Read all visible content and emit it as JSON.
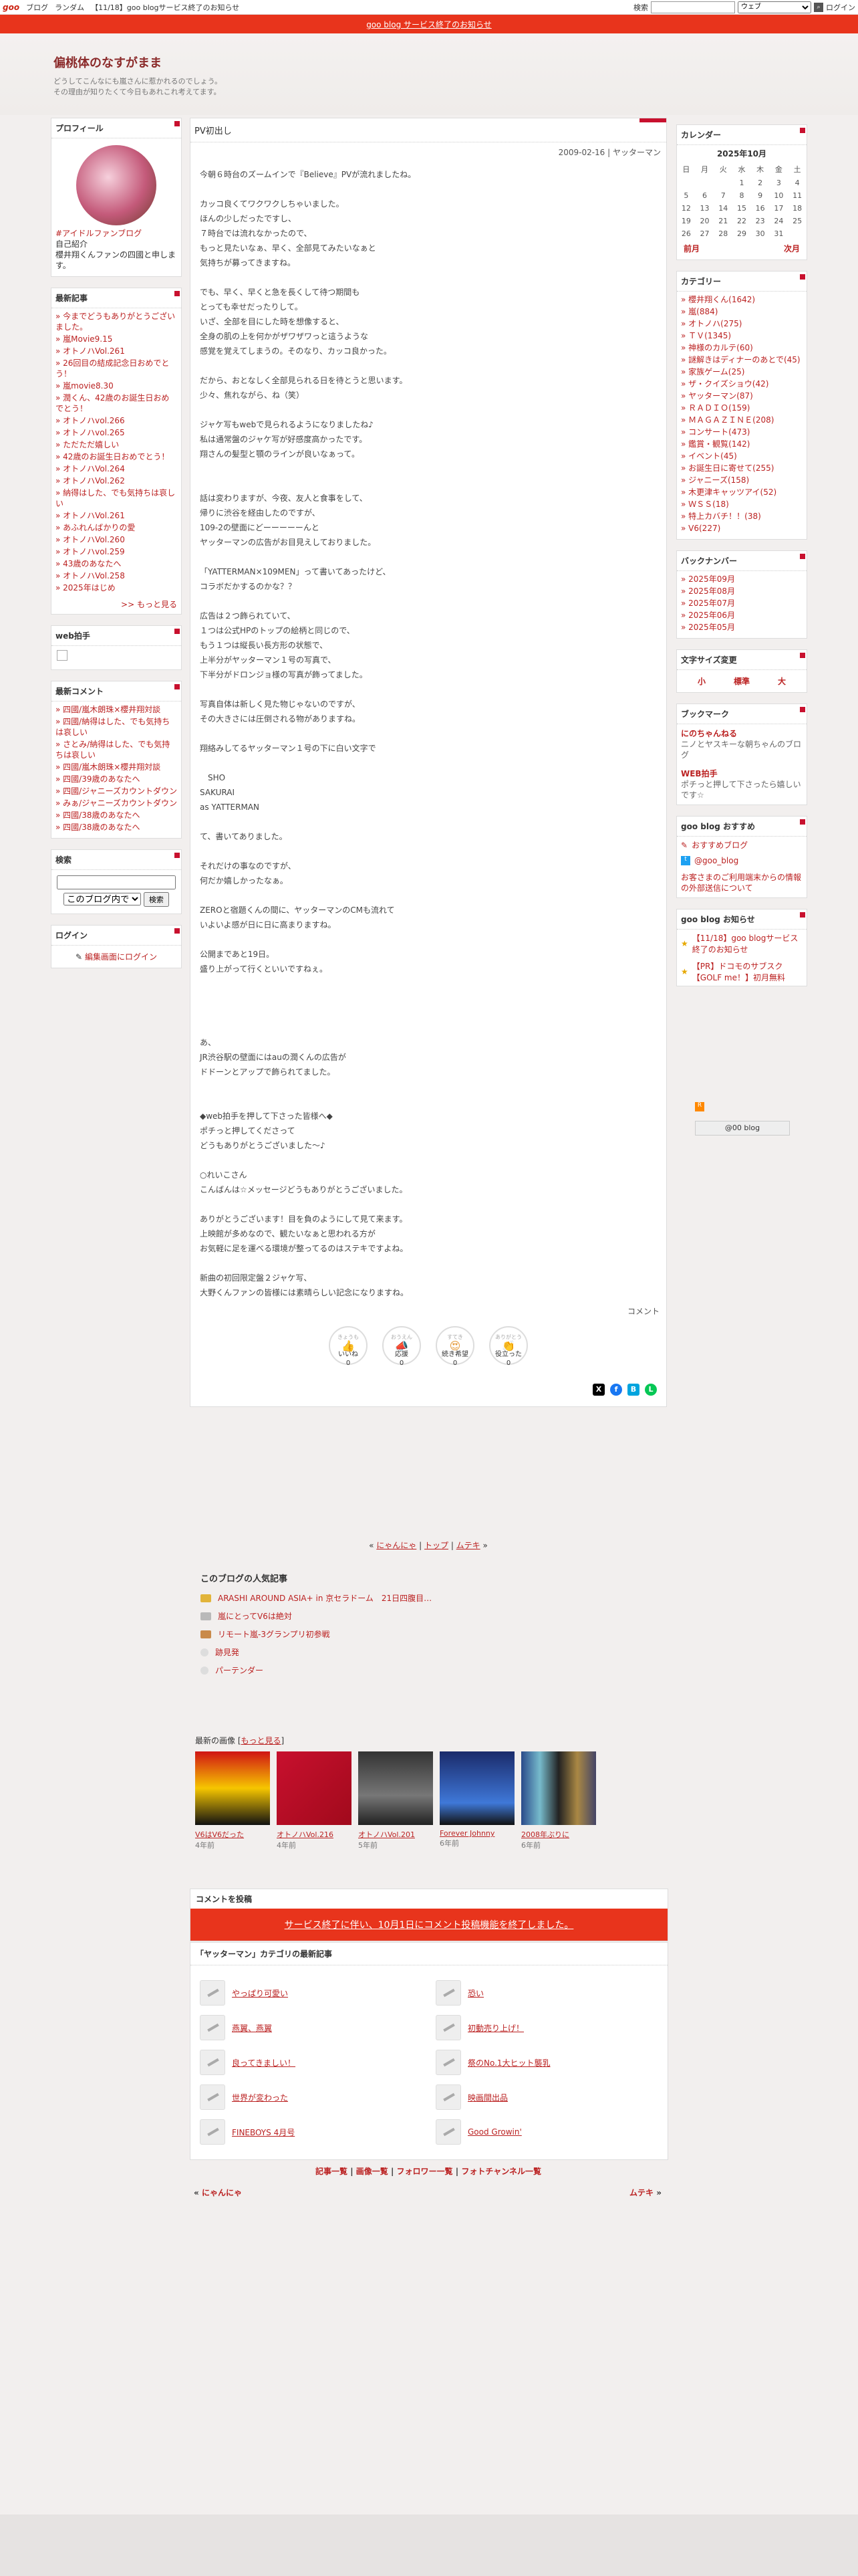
{
  "topbar": {
    "logo": "goo",
    "links": [
      "ブログ",
      "ランダム",
      "【11/18】goo blogサービス終了のお知らせ"
    ],
    "search_label": "検索",
    "search_select": "ウェブ",
    "login": "ログイン"
  },
  "banner": "goo blog サービス終了のお知らせ",
  "blog": {
    "title": "偏桃体のなすがまま",
    "desc1": "どうしてこんなにも嵐さんに惹かれるのでしょう。",
    "desc2": "その理由が知りたくて今日もあれこれ考えてます。"
  },
  "profile": {
    "head": "プロフィール",
    "tag": "#アイドルファンブログ",
    "intro_label": "自己紹介",
    "intro": "櫻井翔くんファンの四國と申します。"
  },
  "recent": {
    "head": "最新記事",
    "items": [
      "今までどうもありがとうございました。",
      "嵐Movie9.15",
      "オトノハVol.261",
      "26回目の結成記念日おめでとう！",
      "嵐movie8.30",
      "潤くん、42歳のお誕生日おめでとう！",
      "オトノハvol.266",
      "オトノハvol.265",
      "ただただ嬉しい",
      "42歳のお誕生日おめでとう！",
      "オトノハVol.264",
      "オトノハVol.262",
      "納得はした、でも気持ちは哀しい",
      "オトノハVol.261",
      "あふれんばかりの愛",
      "オトノハVol.260",
      "オトノハvol.259",
      "43歳のあなたへ",
      "オトノハVol.258",
      "2025年はじめ"
    ],
    "more": "もっと見る"
  },
  "webclap": {
    "head": "web拍手"
  },
  "comments": {
    "head": "最新コメント",
    "items": [
      "四國/嵐木朗珠×櫻井翔対談",
      "四國/納得はした、でも気持ちは哀しい",
      "さとみ/納得はした、でも気持ちは哀しい",
      "四國/嵐木朗珠×櫻井翔対談",
      "四國/39歳のあなたへ",
      "四國/ジャニーズカウントダウン",
      "みぁ/ジャニーズカウントダウン",
      "四國/38歳のあなたへ",
      "四國/38歳のあなたへ"
    ]
  },
  "search": {
    "head": "検索",
    "scope": "このブログ内で",
    "btn": "検索"
  },
  "login": {
    "head": "ログイン",
    "link": "編集画面にログイン"
  },
  "post": {
    "title": "PV初出し",
    "date": "2009-02-16 | ヤッターマン",
    "body": "今朝６時台のズームインで『Believe』PVが流れましたね。\n\nカッコ良くてワクワクしちゃいました。\nほんの少しだったですし、\n７時台では流れなかったので、\nもっと見たいなぁ、早く、全部見てみたいなぁと\n気持ちが募ってきますね。\n\nでも、早く、早くと急を長くして待つ期間も\nとっても幸せだったりして。\nいざ、全部を目にした時を想像すると、\n全身の肌の上を何かがザワザワっと這うような\n感覚を覚えてしまうの。そのなり、カッコ良かった。\n\nだから、おとなしく全部見られる日を待とうと思います。\n少々、焦れながら、ね（笑）\n\nジャケ写もwebで見られるようになりましたね♪\n私は通常盤のジャケ写が好感度高かったです。\n翔さんの髪型と顎のラインが良いなぁって。\n\n\n話は変わりますが、今夜、友人と食事をして、\n帰りに渋谷を経由したのですが、\n109-2の壁面にどーーーーーんと\nヤッターマンの広告がお目見えしておりました。\n\n「YATTERMAN×109MEN」って書いてあったけど、\nコラボだかするのかな？？\n\n広告は２つ飾られていて、\n１つは公式HPのトップの絵柄と同じので、\nもう１つは縦長い長方形の状態で、\n上半分がヤッターマン１号の写真で、\n下半分がドロンジョ様の写真が飾ってました。\n\n写真自体は新しく見た物じゃないのですが、\nその大きさには圧倒される物がありますね。\n\n翔絡みしてるヤッターマン１号の下に白い文字で\n\n　SHO\nSAKURAI\nas YATTERMAN\n\nて、書いてありました。\n\nそれだけの事なのですが、\n何だか嬉しかったなぁ。\n\nZEROと宿題くんの間に、ヤッターマンのCMも流れて\nいよいよ感が日に日に高まりますね。\n\n公開まであと19日。\n盛り上がって行くといいですねぇ。\n\n\n\n\nあ、\nJR渋谷駅の壁面にはauの潤くんの広告が\nドドーンとアップで飾られてました。\n\n\n◆web拍手を押して下さった皆様へ◆\nポチっと押してくださって\nどうもありがとうございました～♪\n\n○れいこさん\nこんばんは☆メッセージどうもありがとうございました。\n\nありがとうございます！目を負のようにして見て来ます。\n上映館が多めなので、観たいなぁと思われる方が\nお気軽に足を運べる環境が整ってるのはステキですよね。\n\n新曲の初回限定盤２ジャケ写、\n大野くんファンの皆様には素晴らしい記念になりますね。",
    "comment_link": "コメント"
  },
  "reactions": [
    {
      "top": "きょうも",
      "label": "いいね",
      "count": "0"
    },
    {
      "top": "おうえん",
      "label": "応援",
      "count": "0"
    },
    {
      "top": "すてき",
      "label": "続き希望",
      "count": "0"
    },
    {
      "top": "ありがとう",
      "label": "役立った",
      "count": "0"
    }
  ],
  "pager": {
    "prev": "にゃんにゃ",
    "top": "トップ",
    "next": "ムテキ"
  },
  "popular": {
    "title": "このブログの人気記事",
    "items": [
      "ARASHI AROUND ASIA+ in 京セラドーム　21日四腹目…",
      "嵐にとってV6は絶対",
      "リモート嵐-3グランプリ初参戦",
      "跡見発",
      "パーテンダー"
    ]
  },
  "images": {
    "title": "最新の画像",
    "more": "もっと見る",
    "items": [
      {
        "label": "V6はV6だった",
        "ago": "4年前"
      },
      {
        "label": "オトノハVol.216",
        "ago": "4年前"
      },
      {
        "label": "オトノハVol.201",
        "ago": "5年前"
      },
      {
        "label": "Forever Johnny",
        "ago": "6年前"
      },
      {
        "label": "2008年ぶりに",
        "ago": "6年前"
      }
    ]
  },
  "comment_post": {
    "head": "コメントを投稿",
    "closed": "サービス終了に伴い、10月1日にコメント投稿機能を終了しました。"
  },
  "cat_recent": {
    "head": "「ヤッターマン」カテゴリの最新記事",
    "items": [
      "やっぱり可愛い",
      "恐い",
      "燕翼、燕翼",
      "初動売り上げ！",
      "良ってきましい！",
      "祭のNo.1大ヒット襲乳",
      "世界が変わった",
      "映画間出品",
      "FINEBOYS 4月号",
      "Good Growin'"
    ]
  },
  "footer": {
    "links": [
      "記事一覧",
      "画像一覧",
      "フォロワー一覧",
      "フォトチャンネル一覧"
    ],
    "prev": "にゃんにゃ",
    "next": "ムテキ"
  },
  "calendar": {
    "head": "カレンダー",
    "month": "2025年10月",
    "days": [
      "日",
      "月",
      "火",
      "水",
      "木",
      "金",
      "土"
    ],
    "weeks": [
      [
        "",
        "",
        "",
        "1",
        "2",
        "3",
        "4"
      ],
      [
        "5",
        "6",
        "7",
        "8",
        "9",
        "10",
        "11"
      ],
      [
        "12",
        "13",
        "14",
        "15",
        "16",
        "17",
        "18"
      ],
      [
        "19",
        "20",
        "21",
        "22",
        "23",
        "24",
        "25"
      ],
      [
        "26",
        "27",
        "28",
        "29",
        "30",
        "31",
        ""
      ]
    ],
    "prev": "前月",
    "next": "次月"
  },
  "categories": {
    "head": "カテゴリー",
    "items": [
      "櫻井翔くん(1642)",
      "嵐(884)",
      "オトノハ(275)",
      "ＴＶ(1345)",
      "神様のカルテ(60)",
      "謎解きはディナーのあとで(45)",
      "家族ゲーム(25)",
      "ザ・クイズショウ(42)",
      "ヤッターマン(87)",
      "ＲＡＤＩＯ(159)",
      "ＭＡＧＡＺＩＮＥ(208)",
      "コンサート(473)",
      "鑑賞・観覧(142)",
      "イベント(45)",
      "お誕生日に寄せて(255)",
      "ジャニーズ(158)",
      "木更津キャッツアイ(52)",
      "ＷＳＳ(18)",
      "特上カバチ！！(38)",
      "V6(227)"
    ]
  },
  "backnumber": {
    "head": "バックナンバー",
    "items": [
      "2025年09月",
      "2025年08月",
      "2025年07月",
      "2025年06月",
      "2025年05月"
    ]
  },
  "textsize": {
    "head": "文字サイズ変更",
    "sizes": [
      "小",
      "標準",
      "大"
    ]
  },
  "bookmark": {
    "head": "ブックマーク",
    "items": [
      {
        "name": "にのちゃんねる",
        "desc": "ニノとヤスキーな朝ちゃんのブログ"
      },
      {
        "name": "WEB拍手",
        "desc": "ポチっと押して下さったら嬉しいです☆"
      }
    ]
  },
  "goo_rec": {
    "head": "goo blog おすすめ",
    "items": [
      "おすすめブログ",
      "@goo_blog"
    ],
    "ext": "お客さまのご利用端末からの情報の外部送信について"
  },
  "goo_news": {
    "head": "goo blog お知らせ",
    "items": [
      "【11/18】goo blogサービス終了のお知らせ",
      "【PR】ドコモのサブスク【GOLF me！】初月無料"
    ]
  },
  "goo_button": "@00 blog",
  "colors": {
    "accent": "#c8102e",
    "banner": "#e8341c",
    "link": "#b22222"
  }
}
